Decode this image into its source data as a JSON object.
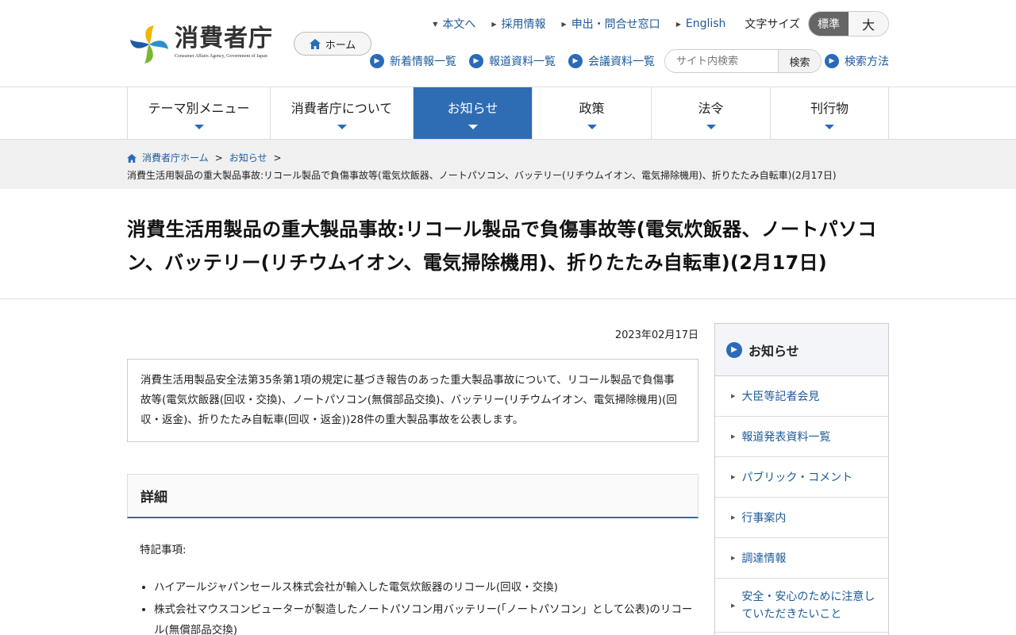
{
  "header": {
    "logo_jp": "消費者庁",
    "logo_en": "Consumer Affairs Agency, Government of Japan",
    "home_button": "ホーム",
    "top_links": [
      "本文へ",
      "採用情報",
      "申出・問合せ窓口",
      "English"
    ],
    "font_size_label": "文字サイズ",
    "font_size_options": {
      "standard": "標準",
      "large": "大"
    },
    "second_links": [
      "新着情報一覧",
      "報道資料一覧",
      "会議資料一覧"
    ],
    "search": {
      "placeholder": "サイト内検索",
      "button": "検索"
    },
    "search_method": "検索方法"
  },
  "gnav": [
    "テーマ別メニュー",
    "消費者庁について",
    "お知らせ",
    "政策",
    "法令",
    "刊行物"
  ],
  "breadcrumb": {
    "home": "消費者庁ホーム",
    "section": "お知らせ",
    "sep": ">",
    "current": "消費生活用製品の重大製品事故:リコール製品で負傷事故等(電気炊飯器、ノートパソコン、バッテリー(リチウムイオン、電気掃除機用)、折りたたみ自転車)(2月17日)"
  },
  "page_title": "消費生活用製品の重大製品事故:リコール製品で負傷事故等(電気炊飯器、ノートパソコン、バッテリー(リチウムイオン、電気掃除機用)、折りたたみ自転車)(2月17日)",
  "content": {
    "date": "2023年02月17日",
    "summary": "消費生活用製品安全法第35条第1項の規定に基づき報告のあった重大製品事故について、リコール製品で負傷事故等(電気炊飯器(回収・交換)、ノートパソコン(無償部品交換)、バッテリー(リチウムイオン、電気掃除機用)(回収・返金)、折りたたみ自転車(回収・返金))28件の重大製品事故を公表します。",
    "detail_heading": "詳細",
    "notice_label": "特記事項:",
    "bullets": [
      "ハイアールジャパンセールス株式会社が輸入した電気炊飯器のリコール(回収・交換)",
      "株式会社マウスコンピューターが製造したノートパソコン用バッテリー(「ノートパソコン」として公表)のリコール(無償部品交換)"
    ]
  },
  "side": {
    "heading": "お知らせ",
    "items": [
      "大臣等記者会見",
      "報道発表資料一覧",
      "パブリック・コメント",
      "行事案内",
      "調達情報",
      "安全・安心のために注意していただきたいこと"
    ]
  }
}
